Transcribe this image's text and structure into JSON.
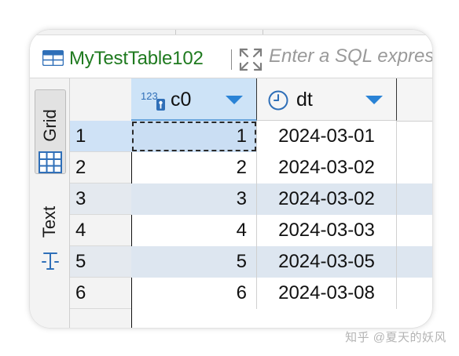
{
  "toolbar": {
    "table_name": "MyTestTable102",
    "sql_placeholder": "Enter a SQL expression to filter results"
  },
  "side_tabs": {
    "grid": "Grid",
    "text": "Text"
  },
  "columns": [
    {
      "name": "c0",
      "type_icon": "numeric-type-icon"
    },
    {
      "name": "dt",
      "type_icon": "clock-icon"
    }
  ],
  "rows": [
    {
      "num": "1",
      "c0": "1",
      "dt": "2024-03-01"
    },
    {
      "num": "2",
      "c0": "2",
      "dt": "2024-03-02"
    },
    {
      "num": "3",
      "c0": "3",
      "dt": "2024-03-02"
    },
    {
      "num": "4",
      "c0": "4",
      "dt": "2024-03-03"
    },
    {
      "num": "5",
      "c0": "5",
      "dt": "2024-03-05"
    },
    {
      "num": "6",
      "c0": "6",
      "dt": "2024-03-08"
    }
  ],
  "watermark": "知乎 @夏天的妖风",
  "colors": {
    "accent": "#2a83d6",
    "title_green": "#1f7a1f",
    "selected": "#cde3f7",
    "alt_row": "#dde6f0"
  }
}
